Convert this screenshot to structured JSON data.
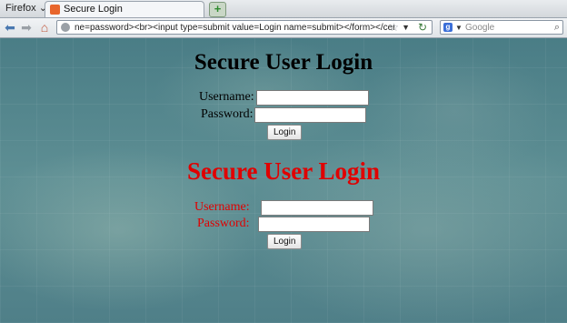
{
  "browser": {
    "app_menu_label": "Firefox",
    "tab_title": "Secure Login",
    "new_tab_symbol": "+",
    "url": "ne=password><br><input type=submit value=Login name=submit></form></center>",
    "search_placeholder": "Google"
  },
  "forms": [
    {
      "heading": "Secure User Login",
      "username_label": "Username:",
      "password_label": "Password:",
      "username_value": "",
      "password_value": "",
      "submit_label": "Login",
      "color": "#000000"
    },
    {
      "heading": "Secure User Login",
      "username_label": "Username:",
      "password_label": "Password:",
      "username_value": "",
      "password_value": "",
      "submit_label": "Login",
      "color": "#e00000"
    }
  ]
}
